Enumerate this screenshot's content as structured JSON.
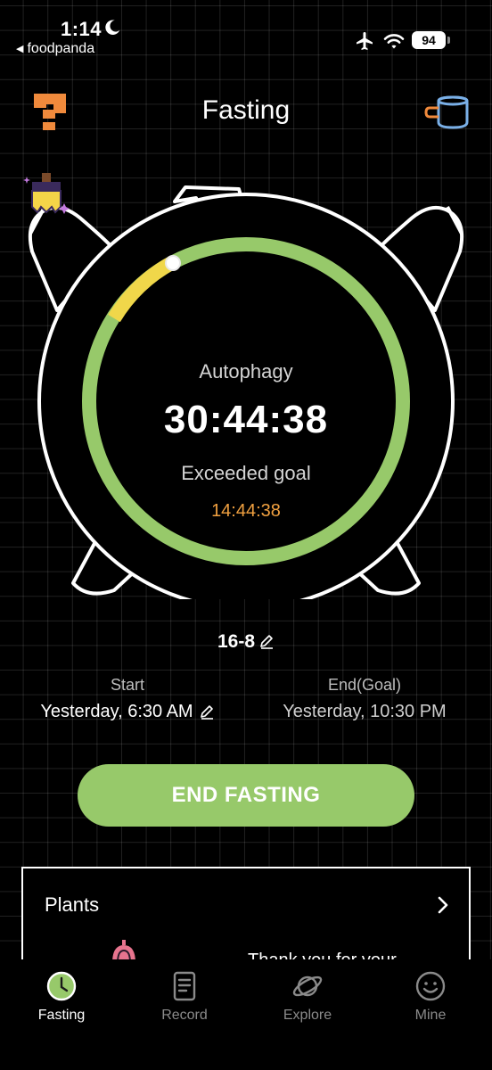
{
  "status_bar": {
    "time": "1:14",
    "back_app": "foodpanda",
    "battery": "94"
  },
  "header": {
    "title": "Fasting",
    "left_icon": "question-mark-icon",
    "right_icon": "cup-icon"
  },
  "timer": {
    "phase_icon": "brush-icon",
    "phase": "Autophagy",
    "elapsed": "30:44:38",
    "exceeded_label": "Exceeded goal",
    "exceeded_time": "14:44:38",
    "ring_color": "#97c96a",
    "ring_start_color": "#f0d74a"
  },
  "plan": {
    "label": "16-8"
  },
  "start": {
    "label": "Start",
    "value": "Yesterday, 6:30 AM"
  },
  "end": {
    "label": "End(Goal)",
    "value": "Yesterday, 10:30 PM"
  },
  "actions": {
    "end_fasting": "END FASTING"
  },
  "plants": {
    "title": "Plants",
    "preview_text": "Thank you for your"
  },
  "tabs": [
    {
      "label": "Fasting",
      "icon": "clock-icon",
      "active": true
    },
    {
      "label": "Record",
      "icon": "clipboard-icon",
      "active": false
    },
    {
      "label": "Explore",
      "icon": "planet-icon",
      "active": false
    },
    {
      "label": "Mine",
      "icon": "smiley-icon",
      "active": false
    }
  ],
  "colors": {
    "accent_green": "#97c96a",
    "accent_orange": "#f0a040",
    "help_icon_orange": "#f08a3c",
    "cup_icon_blue": "#7ab0e8"
  }
}
